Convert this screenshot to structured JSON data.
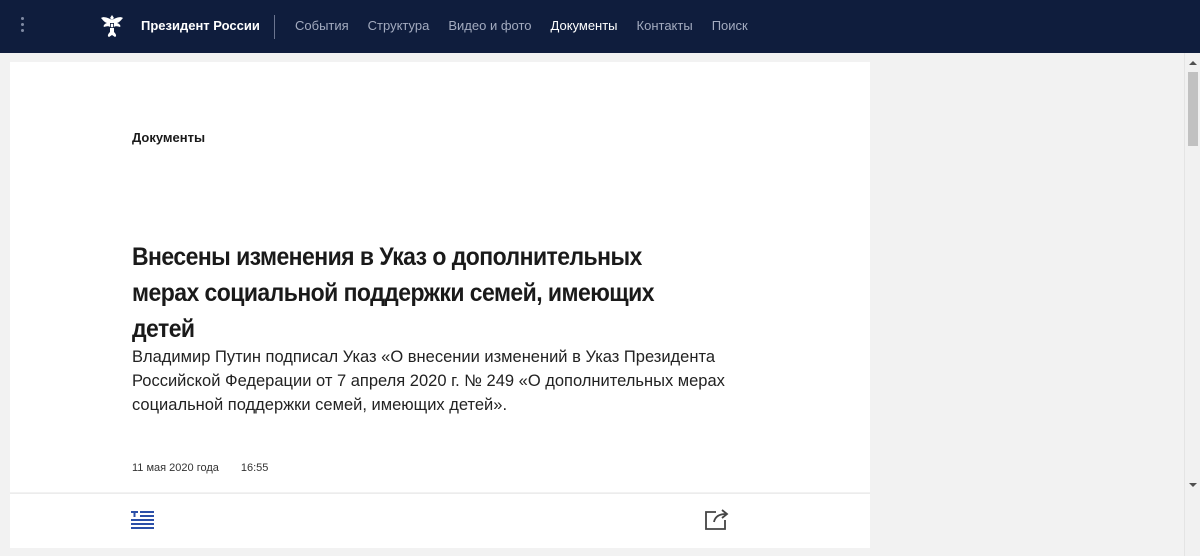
{
  "header": {
    "site_title": "Президент России",
    "nav": [
      {
        "label": "События",
        "active": false
      },
      {
        "label": "Структура",
        "active": false
      },
      {
        "label": "Видео и фото",
        "active": false
      },
      {
        "label": "Документы",
        "active": true
      },
      {
        "label": "Контакты",
        "active": false
      },
      {
        "label": "Поиск",
        "active": false
      }
    ],
    "icons": {
      "menu": "vertical-dots-icon",
      "emblem": "double-headed-eagle-emblem"
    }
  },
  "article": {
    "section": "Документы",
    "title": "Внесены изменения в Указ о дополнительных мерах социальной поддержки семей, имеющих детей",
    "lead": "Владимир Путин подписал Указ «О внесении изменений в Указ Президента Российской Федерации от 7 апреля 2020 г. № 249 «О дополнительных мерах социальной поддержки семей, имеющих детей».",
    "date": "11 мая 2020 года",
    "time": "16:55"
  },
  "toolbar": {
    "icons": {
      "text_version": "text-version-icon",
      "share": "share-icon"
    }
  },
  "colors": {
    "header_bg": "#0f1d3d",
    "nav_text": "#a3abbf",
    "nav_active": "#ffffff",
    "page_bg": "#f2f2f2",
    "card_bg": "#ffffff",
    "accent_blue": "#2b4fa8"
  }
}
